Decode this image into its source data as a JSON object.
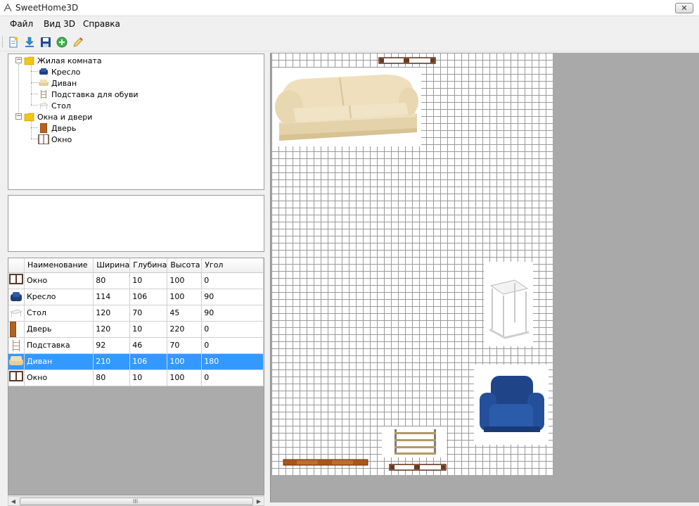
{
  "window": {
    "title": "SweetHome3D",
    "close_symbol": "✕"
  },
  "menu": [
    {
      "label": "Файл"
    },
    {
      "label": "Вид 3D"
    },
    {
      "label": "Справка"
    }
  ],
  "toolbar": [
    "new-document-icon",
    "download-icon",
    "save-icon",
    "add-icon",
    "edit-icon"
  ],
  "tree": {
    "categories": [
      {
        "label": "Жилая комната",
        "expanded": true,
        "items": [
          {
            "label": "Кресло"
          },
          {
            "label": "Диван"
          },
          {
            "label": "Подставка для обуви"
          },
          {
            "label": "Стол"
          }
        ]
      },
      {
        "label": "Окна и двери",
        "expanded": true,
        "items": [
          {
            "label": "Дверь"
          },
          {
            "label": "Окно"
          }
        ]
      }
    ],
    "expander_symbol": "−"
  },
  "table": {
    "columns": [
      "Наименование",
      "Ширина",
      "Глубина",
      "Высота",
      "Угол"
    ],
    "rows": [
      {
        "name": "Окно",
        "width": "80",
        "depth": "10",
        "height": "100",
        "angle": "0",
        "icon": "window-icon"
      },
      {
        "name": "Кресло",
        "width": "114",
        "depth": "106",
        "height": "100",
        "angle": "90",
        "icon": "armchair-icon"
      },
      {
        "name": "Стол",
        "width": "120",
        "depth": "70",
        "height": "45",
        "angle": "90",
        "icon": "table-icon"
      },
      {
        "name": "Дверь",
        "width": "120",
        "depth": "10",
        "height": "220",
        "angle": "0",
        "icon": "door-icon"
      },
      {
        "name": "Подставка",
        "width": "92",
        "depth": "46",
        "height": "70",
        "angle": "0",
        "icon": "shoe-rack-icon"
      },
      {
        "name": "Диван",
        "width": "210",
        "depth": "106",
        "height": "100",
        "angle": "180",
        "icon": "sofa-icon",
        "selected": true
      },
      {
        "name": "Окно",
        "width": "80",
        "depth": "10",
        "height": "100",
        "angle": "0",
        "icon": "window-icon"
      }
    ]
  },
  "scrollbar": {
    "left_arrow": "◀",
    "right_arrow": "▶",
    "grip": "III"
  },
  "colors": {
    "selection": "#3399ff",
    "plan_background": "#a9a9a9",
    "grid_line": "#9a9a9a"
  }
}
